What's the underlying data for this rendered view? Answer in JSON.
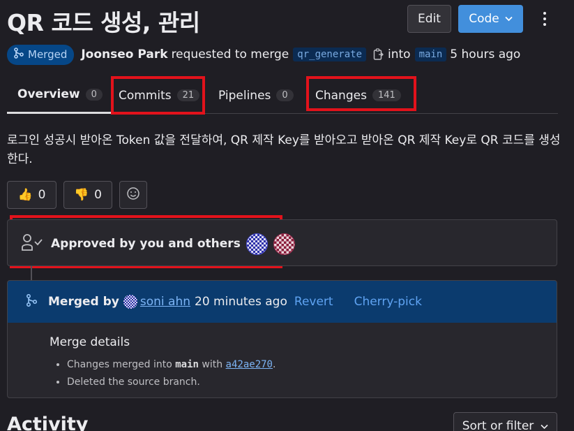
{
  "header": {
    "title": "QR 코드 생성, 관리",
    "edit_label": "Edit",
    "code_label": "Code"
  },
  "meta": {
    "status_badge": "Merged",
    "author": "Joonseo Park",
    "requested_text": "requested to merge",
    "source_branch": "qr_generate",
    "into_text": "into",
    "target_branch": "main",
    "time": "5 hours ago"
  },
  "tabs": [
    {
      "label": "Overview",
      "count": "0"
    },
    {
      "label": "Commits",
      "count": "21"
    },
    {
      "label": "Pipelines",
      "count": "0"
    },
    {
      "label": "Changes",
      "count": "141"
    }
  ],
  "description": "로그인 성공시 받아온 Token 값을 전달하여, QR 제작 Key를 받아오고 받아온 QR 제작 Key로 QR 코드를 생성한다.",
  "reactions": {
    "thumbs_up": "0",
    "thumbs_down": "0"
  },
  "approval": {
    "text": "Approved by you and others"
  },
  "merged": {
    "merged_by": "Merged by",
    "user": "soni ahn",
    "time": "20 minutes ago",
    "revert_label": "Revert",
    "cherry_pick_label": "Cherry-pick",
    "details_title": "Merge details",
    "line1_prefix": "Changes merged into",
    "line1_branch": "main",
    "line1_with": "with",
    "line1_sha": "a42ae270",
    "line1_suffix": ".",
    "line2": "Deleted the source branch."
  },
  "activity": {
    "title": "Activity",
    "sort_label": "Sort or filter"
  },
  "colors": {
    "background": "#1f1e24",
    "accent": "#428fdc",
    "merged_badge": "#064787",
    "highlight": "#e2121b"
  }
}
